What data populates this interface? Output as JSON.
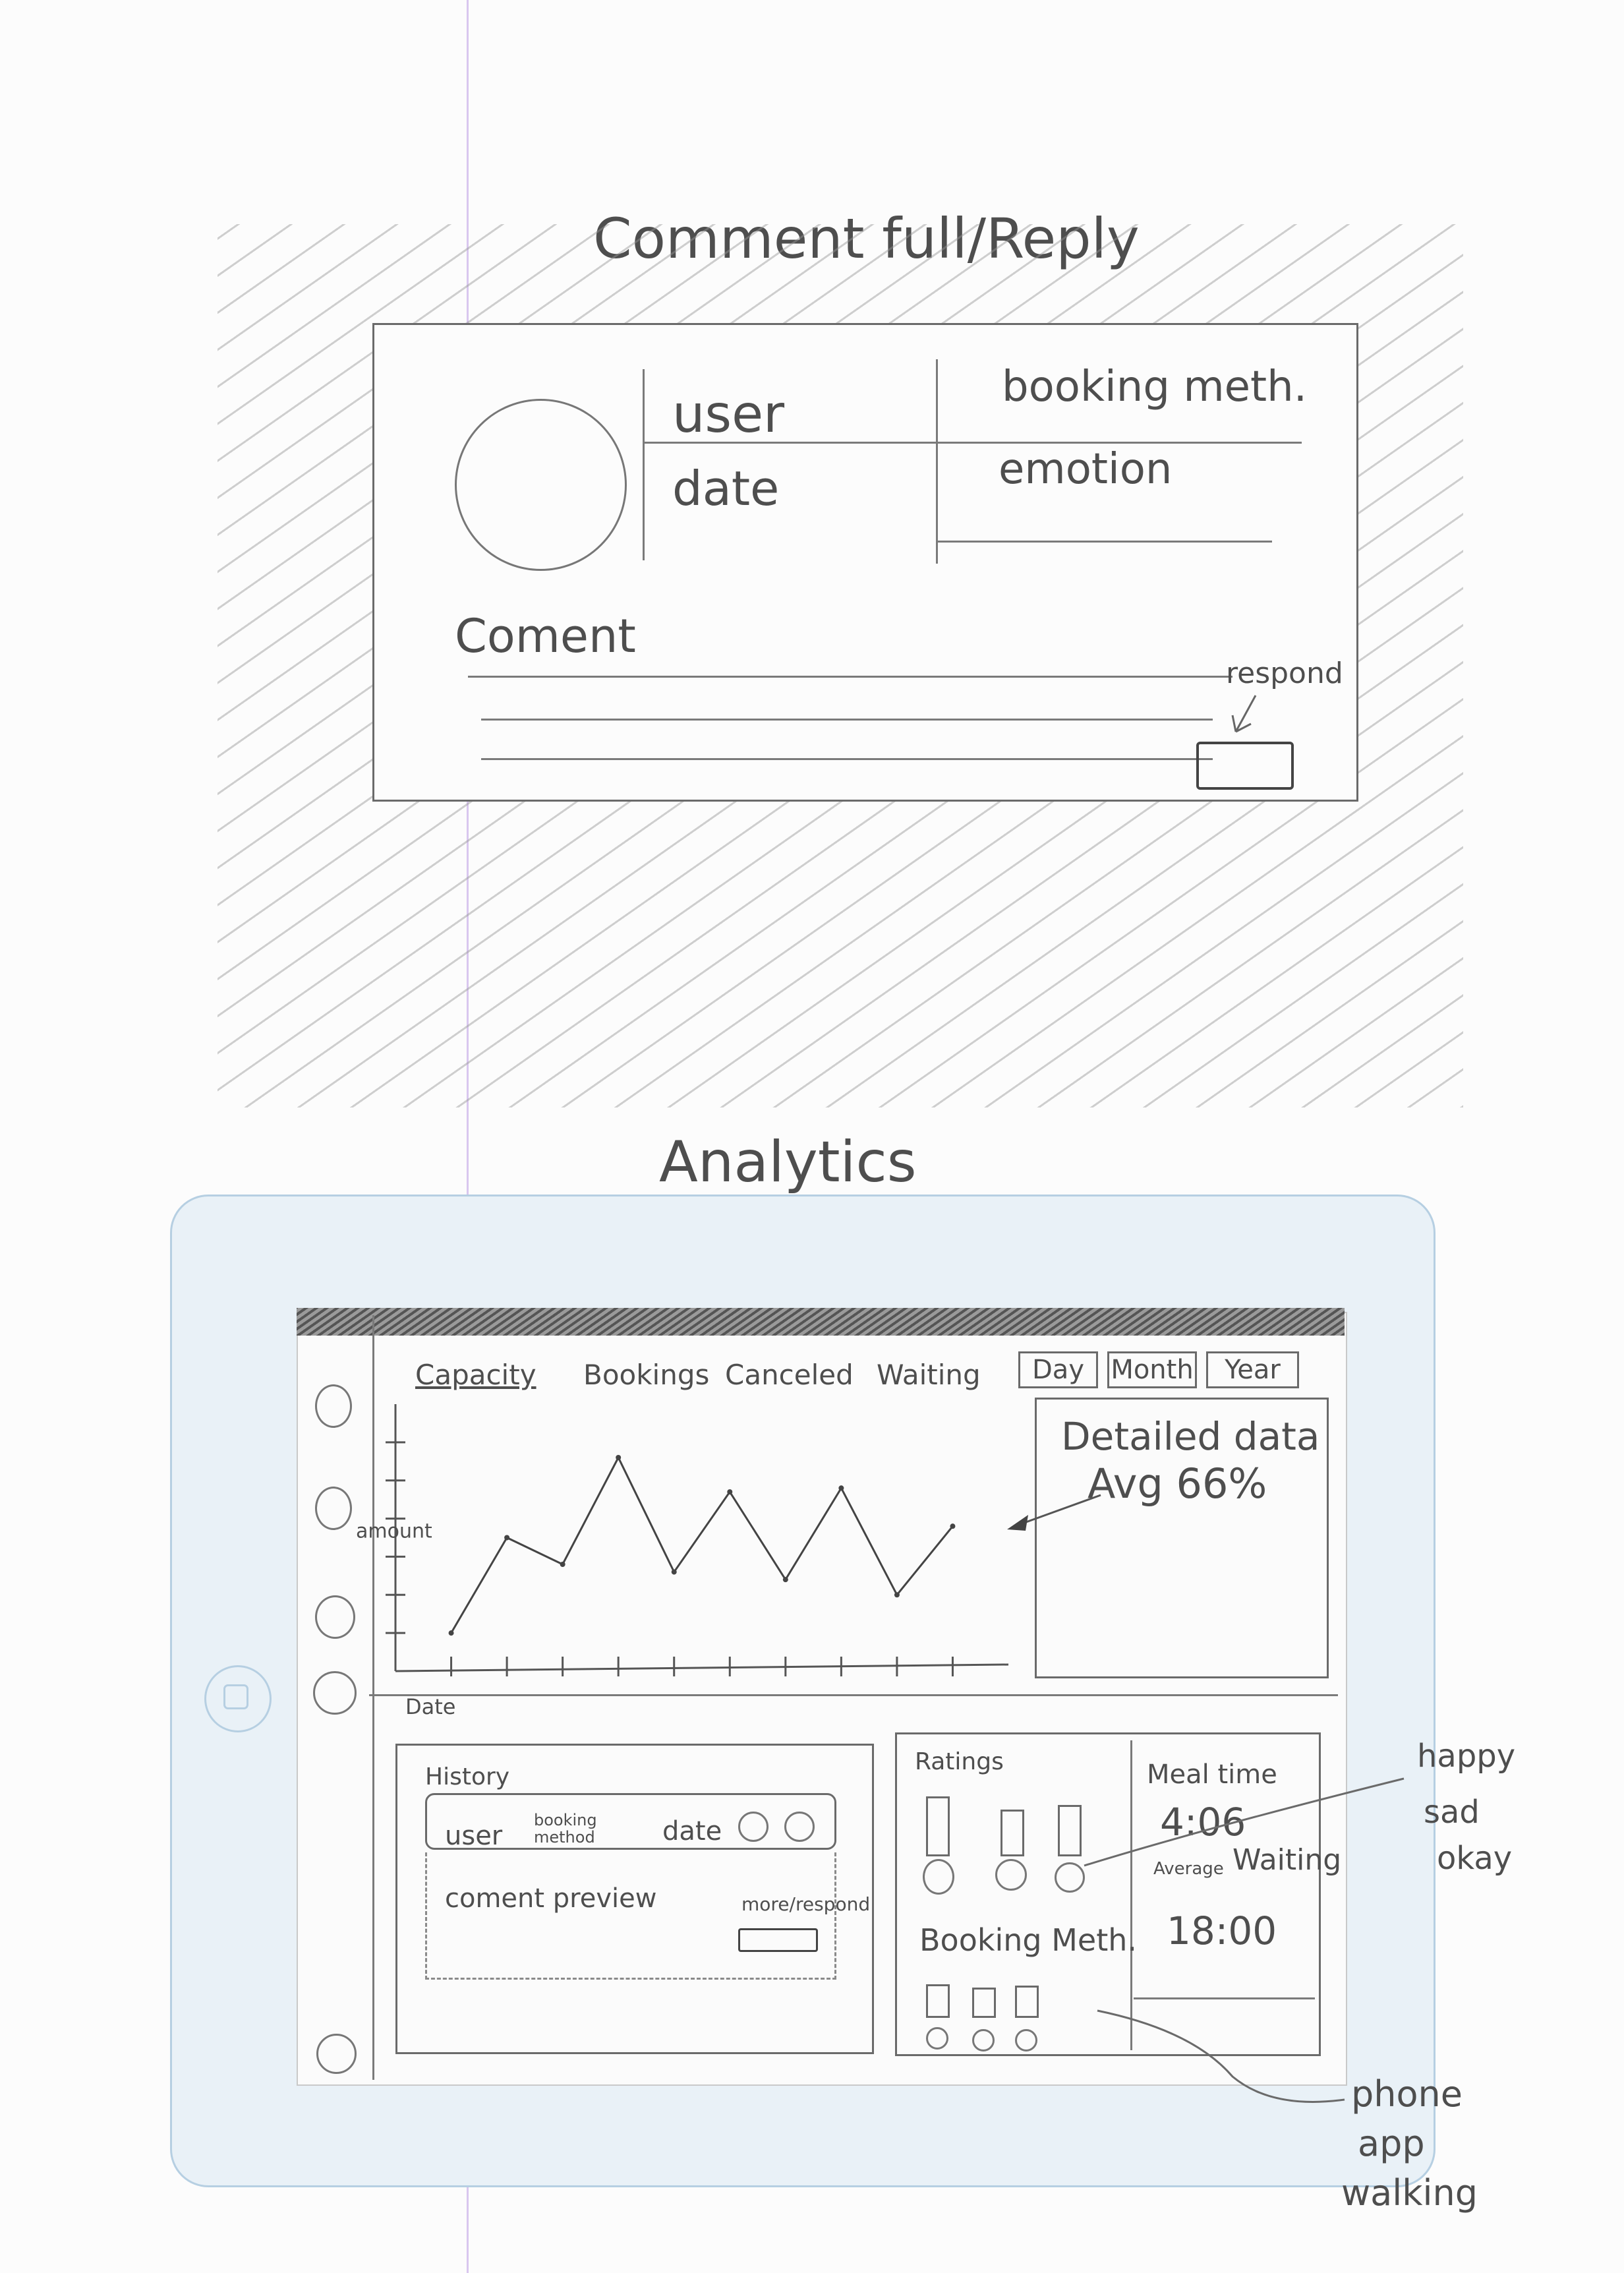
{
  "sketch1": {
    "title": "Comment full/Reply",
    "fields": {
      "user": "user",
      "date": "date",
      "booking_method": "booking meth.",
      "emotion": "emotion"
    },
    "comment_label": "Coment",
    "respond_note": "respond"
  },
  "sketch2": {
    "title": "Analytics",
    "nav_tabs": [
      "Capacity",
      "Bookings",
      "Canceled",
      "Waiting"
    ],
    "period_buttons": [
      "Day",
      "Month",
      "Year"
    ],
    "chart_data": {
      "type": "line",
      "ylabel": "amount",
      "xlabel": "Date",
      "x": [
        1,
        2,
        3,
        4,
        5,
        6,
        7,
        8,
        9,
        10
      ],
      "values": [
        1.0,
        3.5,
        2.8,
        5.6,
        2.6,
        4.7,
        2.4,
        4.8,
        2.0,
        3.8
      ],
      "xlim": [
        0,
        11
      ],
      "ylim": [
        0,
        7
      ]
    },
    "detail_panel": {
      "title": "Detailed data",
      "avg": "Avg 66%"
    },
    "history": {
      "title": "History",
      "row_user": "user",
      "row_booking": "booking method",
      "row_date": "date",
      "preview": "coment preview",
      "more": "more/respond"
    },
    "ratings": {
      "title": "Ratings",
      "booking_method": "Booking Meth."
    },
    "stats": {
      "meal_label": "Meal time",
      "meal_value": "4:06",
      "avg_label": "Average",
      "waiting_label": "Waiting",
      "waiting_value": "18:00"
    }
  },
  "annotations": {
    "happy": "happy",
    "sad": "sad",
    "okay": "okay",
    "phone": "phone",
    "app": "app",
    "walking": "walking"
  }
}
